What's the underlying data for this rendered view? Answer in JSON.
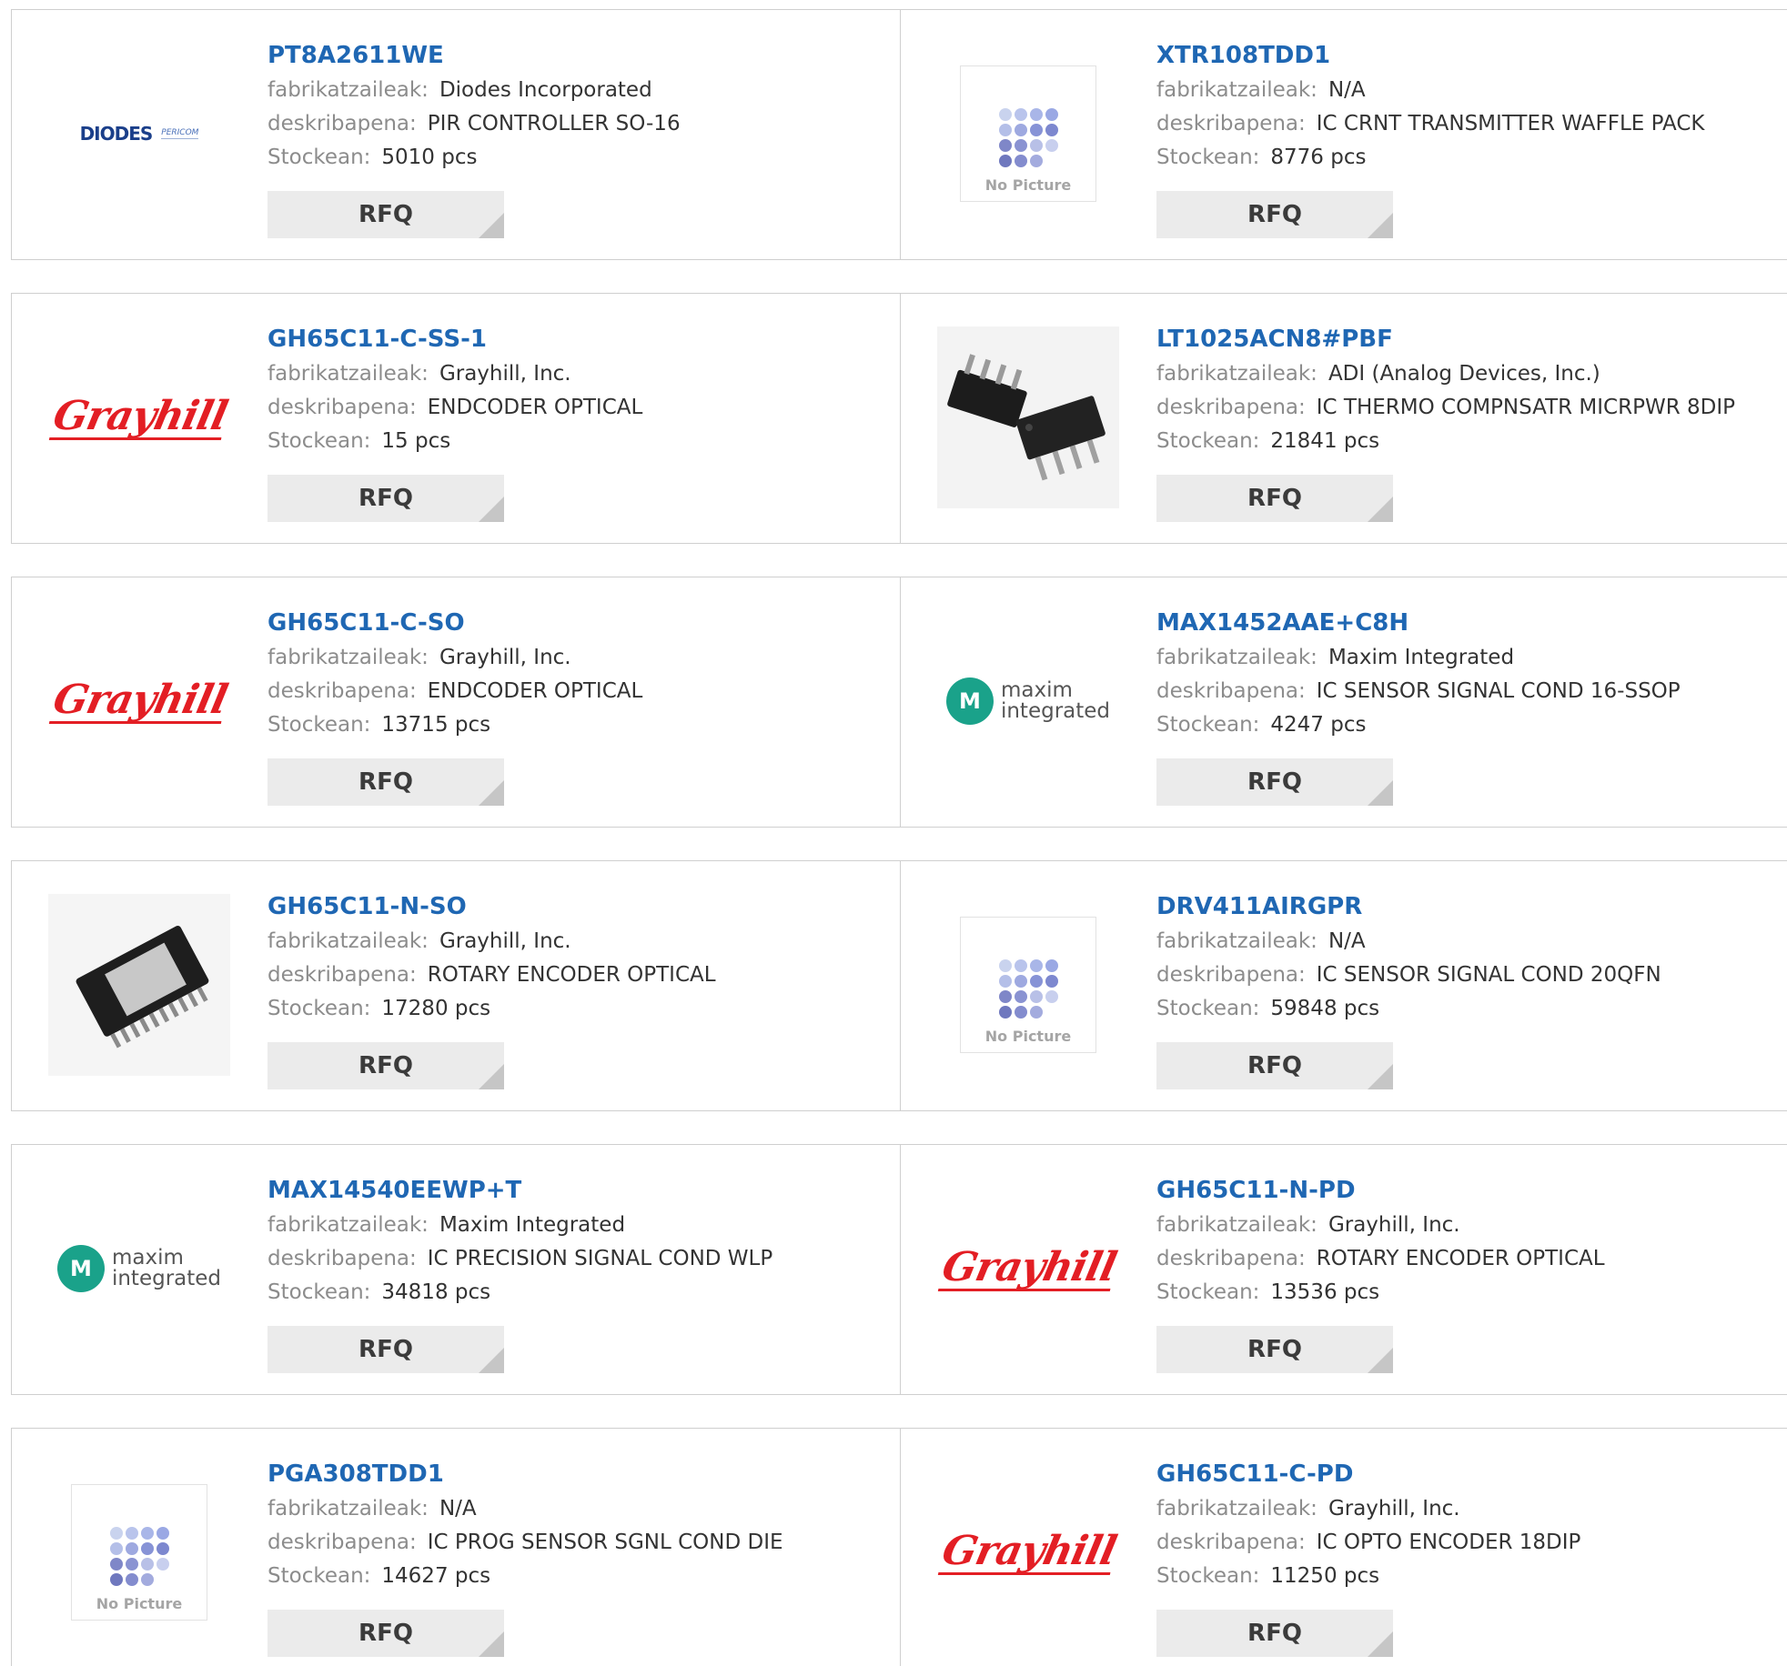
{
  "labels": {
    "manufacturer": "fabrikatzaileak:",
    "description": "deskribapena:",
    "stock": "Stockean:",
    "rfq": "RFQ",
    "no_picture": "No Picture"
  },
  "logos": {
    "diodes": {
      "name": "DIODES",
      "sub": "PERICOM"
    },
    "grayhill": {
      "name": "Grayhill"
    },
    "maxim": {
      "mark": "M",
      "line1": "maxim",
      "line2": "integrated"
    }
  },
  "colors": {
    "link": "#1f67b3",
    "grayhill_red": "#e31e24",
    "maxim_teal": "#1aa28a",
    "rfq_bg": "#ebebeb"
  },
  "products": [
    {
      "part": "PT8A2611WE",
      "manufacturer": "Diodes Incorporated",
      "description": "PIR CONTROLLER SO-16",
      "stock": "5010 pcs",
      "image": "diodes-logo"
    },
    {
      "part": "XTR108TDD1",
      "manufacturer": "N/A",
      "description": "IC CRNT TRANSMITTER WAFFLE PACK",
      "stock": "8776 pcs",
      "image": "no-picture"
    },
    {
      "part": "GH65C11-C-SS-1",
      "manufacturer": "Grayhill, Inc.",
      "description": "ENDCODER OPTICAL",
      "stock": "15 pcs",
      "image": "grayhill-logo"
    },
    {
      "part": "LT1025ACN8#PBF",
      "manufacturer": "ADI (Analog Devices, Inc.)",
      "description": "IC THERMO COMPNSATR MICRPWR 8DIP",
      "stock": "21841 pcs",
      "image": "dip-chip-photo"
    },
    {
      "part": "GH65C11-C-SO",
      "manufacturer": "Grayhill, Inc.",
      "description": "ENDCODER OPTICAL",
      "stock": "13715 pcs",
      "image": "grayhill-logo"
    },
    {
      "part": "MAX1452AAE+C8H",
      "manufacturer": "Maxim Integrated",
      "description": "IC SENSOR SIGNAL COND 16-SSOP",
      "stock": "4247 pcs",
      "image": "maxim-logo"
    },
    {
      "part": "GH65C11-N-SO",
      "manufacturer": "Grayhill, Inc.",
      "description": "ROTARY ENCODER OPTICAL",
      "stock": "17280 pcs",
      "image": "soic-chip-photo"
    },
    {
      "part": "DRV411AIRGPR",
      "manufacturer": "N/A",
      "description": "IC SENSOR SIGNAL COND 20QFN",
      "stock": "59848 pcs",
      "image": "no-picture"
    },
    {
      "part": "MAX14540EEWP+T",
      "manufacturer": "Maxim Integrated",
      "description": "IC PRECISION SIGNAL COND WLP",
      "stock": "34818 pcs",
      "image": "maxim-logo"
    },
    {
      "part": "GH65C11-N-PD",
      "manufacturer": "Grayhill, Inc.",
      "description": "ROTARY ENCODER OPTICAL",
      "stock": "13536 pcs",
      "image": "grayhill-logo"
    },
    {
      "part": "PGA308TDD1",
      "manufacturer": "N/A",
      "description": "IC PROG SENSOR SGNL COND DIE",
      "stock": "14627 pcs",
      "image": "no-picture"
    },
    {
      "part": "GH65C11-C-PD",
      "manufacturer": "Grayhill, Inc.",
      "description": "IC OPTO ENCODER 18DIP",
      "stock": "11250 pcs",
      "image": "grayhill-logo"
    }
  ]
}
